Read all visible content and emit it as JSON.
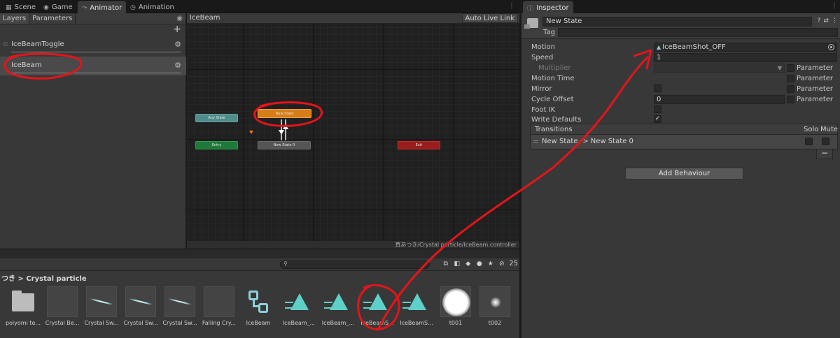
{
  "tabs": {
    "scene": "Scene",
    "game": "Game",
    "animator": "Animator",
    "animation": "Animation",
    "inspector": "Inspector"
  },
  "layers_panel": {
    "tab_layers": "Layers",
    "tab_parameters": "Parameters",
    "layers": [
      {
        "name": "IceBeamToggle"
      },
      {
        "name": "IceBeam"
      }
    ]
  },
  "graph": {
    "breadcrumb": "IceBeam",
    "auto_live_link": "Auto Live Link",
    "nodes": {
      "any_state": "Any State",
      "entry": "Entry",
      "exit": "Exit",
      "new_state": "New State",
      "new_state_0": "New State 0"
    },
    "path": "真あつき/Crystal particle/IceBeam.controller"
  },
  "project": {
    "breadcrumb": "つき > Crystal particle",
    "hidden_count": "25",
    "assets": [
      {
        "label": "poiyomi te..."
      },
      {
        "label": "Crystal Be..."
      },
      {
        "label": "Crystal Sw..."
      },
      {
        "label": "Crystal Sw..."
      },
      {
        "label": "Crystal Sw..."
      },
      {
        "label": "Falling Cry..."
      },
      {
        "label": "IceBeam"
      },
      {
        "label": "IceBeam_..."
      },
      {
        "label": "IceBeam_..."
      },
      {
        "label": "IceBeamS..."
      },
      {
        "label": "IceBeamS..."
      },
      {
        "label": "t001"
      },
      {
        "label": "t002"
      }
    ]
  },
  "inspector": {
    "name": "New State",
    "tag_label": "Tag",
    "tag_value": "",
    "motion_label": "Motion",
    "motion_value": "IceBeamShot_OFF",
    "speed_label": "Speed",
    "speed_value": "1",
    "multiplier_label": "Multiplier",
    "motion_time_label": "Motion Time",
    "mirror_label": "Mirror",
    "cycle_offset_label": "Cycle Offset",
    "cycle_offset_value": "0",
    "foot_ik_label": "Foot IK",
    "write_defaults_label": "Write Defaults",
    "write_defaults_checked": true,
    "parameter_label": "Parameter",
    "transitions_title": "Transitions",
    "solo_label": "Solo",
    "mute_label": "Mute",
    "transitions": [
      {
        "label": "New State -> New State 0"
      }
    ],
    "minus_label": "−",
    "add_behaviour": "Add Behaviour"
  },
  "colors": {
    "annotation": "#e5141b",
    "new_state_node": "#d67d18",
    "entry_node": "#1e7a3a",
    "exit_node": "#9a1c1c",
    "any_state_node": "#4f8c8c",
    "asset_accent": "#5fd0c8"
  }
}
